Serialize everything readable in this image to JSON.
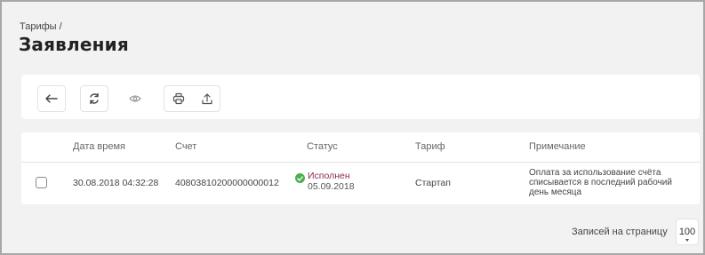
{
  "breadcrumb": {
    "parent": "Тарифы /"
  },
  "page": {
    "title": "Заявления"
  },
  "toolbar": {
    "buttons": [
      {
        "name": "back",
        "icon": "arrow-left-icon"
      },
      {
        "name": "refresh",
        "icon": "refresh-icon"
      },
      {
        "name": "view",
        "icon": "eye-icon"
      },
      {
        "name": "print",
        "icon": "printer-icon"
      },
      {
        "name": "export",
        "icon": "upload-icon"
      }
    ]
  },
  "table": {
    "columns": [
      "Дата время",
      "Счет",
      "Статус",
      "Тариф",
      "Примечание"
    ],
    "rows": [
      {
        "datetime": "30.08.2018 04:32:28",
        "account": "40803810200000000012",
        "status_label": "Исполнен",
        "status_date": "05.09.2018",
        "tariff": "Стартап",
        "note": "Оплата за использование счёта списывается в последний рабочий день месяца"
      }
    ]
  },
  "pager": {
    "label": "Записей на страницу",
    "page_size": "100"
  },
  "colors": {
    "status_success": "#4caf50",
    "status_text": "#8a2c55",
    "background": "#f2f2f2"
  }
}
